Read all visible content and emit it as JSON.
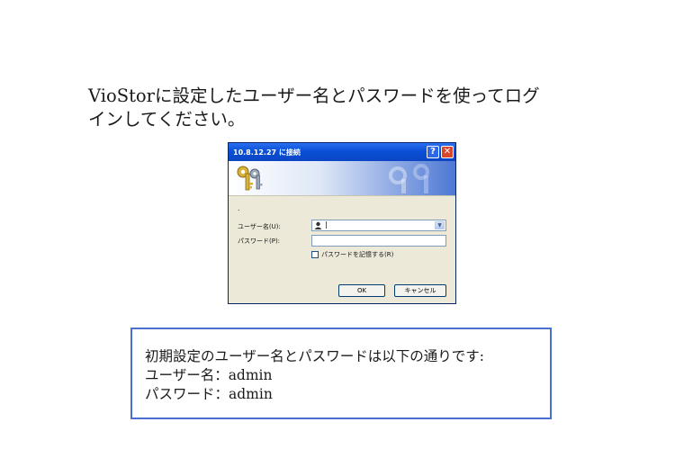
{
  "instruction": {
    "line1": "VioStorに設定したユーザー名とパスワードを使ってログ",
    "line2": "インしてください。"
  },
  "dialog": {
    "title": "10.8.12.27 に接続",
    "help_label": "?",
    "close_label": "✕",
    "realm_text": ".",
    "username_label": "ユーザー名(U):",
    "username_value": "|",
    "password_label": "パスワード(P):",
    "password_value": "",
    "remember_label": "パスワードを記憶する(R)",
    "remember_checked": false,
    "ok_label": "OK",
    "cancel_label": "キャンセル",
    "icons": [
      "keys-icon",
      "user-icon",
      "chevron-down-icon"
    ]
  },
  "note": {
    "line1": "初期設定のユーザー名とパスワードは以下の通りです:",
    "line2": "ユーザー名：admin",
    "line3": "パスワード：admin"
  },
  "colors": {
    "title_bar": "#0a4fd6",
    "note_border": "#4a6fd1",
    "dialog_bg": "#ece9d8"
  }
}
